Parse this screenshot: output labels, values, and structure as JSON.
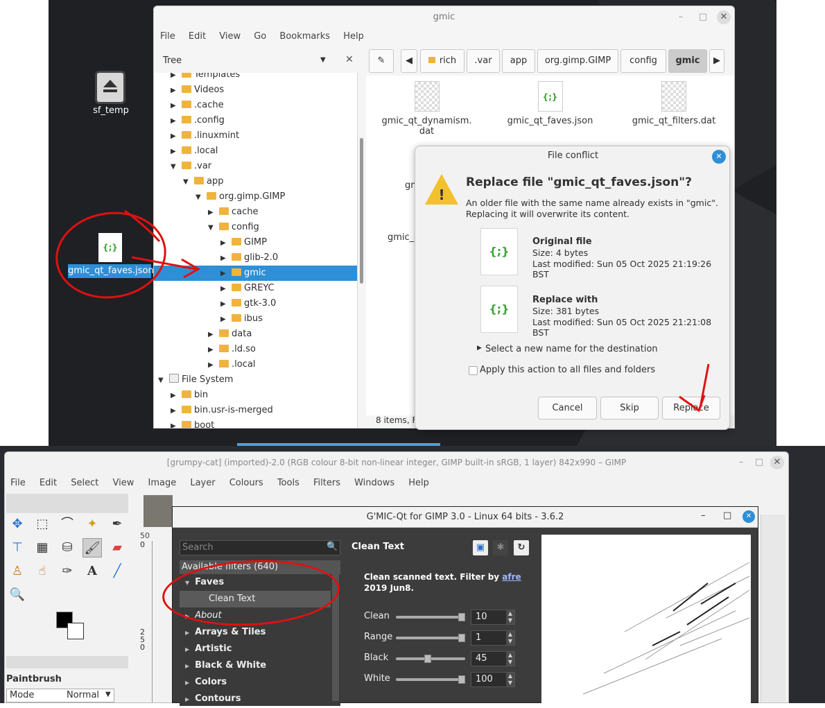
{
  "desktop": {
    "icon1_label": "sf_temp",
    "icon2_label": "gmic_qt_faves.json"
  },
  "nemo": {
    "title": "gmic",
    "menu": [
      "File",
      "Edit",
      "View",
      "Go",
      "Bookmarks",
      "Help"
    ],
    "sidebar_mode": "Tree",
    "breadcrumbs": [
      "rich",
      ".var",
      "app",
      "org.gimp.GIMP",
      "config",
      "gmic"
    ],
    "tree": [
      {
        "label": "Templates",
        "depth": 1,
        "arrow": "▶"
      },
      {
        "label": "Videos",
        "depth": 1,
        "arrow": "▶"
      },
      {
        "label": ".cache",
        "depth": 1,
        "arrow": "▶"
      },
      {
        "label": ".config",
        "depth": 1,
        "arrow": "▶"
      },
      {
        "label": ".linuxmint",
        "depth": 1,
        "arrow": "▶"
      },
      {
        "label": ".local",
        "depth": 1,
        "arrow": "▶"
      },
      {
        "label": ".var",
        "depth": 1,
        "arrow": "▼"
      },
      {
        "label": "app",
        "depth": 2,
        "arrow": "▼"
      },
      {
        "label": "org.gimp.GIMP",
        "depth": 3,
        "arrow": "▼"
      },
      {
        "label": "cache",
        "depth": 4,
        "arrow": "▶"
      },
      {
        "label": "config",
        "depth": 4,
        "arrow": "▼"
      },
      {
        "label": "GIMP",
        "depth": 5,
        "arrow": "▶"
      },
      {
        "label": "glib-2.0",
        "depth": 5,
        "arrow": "▶"
      },
      {
        "label": "gmic",
        "depth": 5,
        "arrow": "▶",
        "selected": true
      },
      {
        "label": "GREYC",
        "depth": 5,
        "arrow": "▶"
      },
      {
        "label": "gtk-3.0",
        "depth": 5,
        "arrow": "▶"
      },
      {
        "label": "ibus",
        "depth": 5,
        "arrow": "▶"
      },
      {
        "label": "data",
        "depth": 4,
        "arrow": "▶"
      },
      {
        "label": ".ld.so",
        "depth": 4,
        "arrow": "▶"
      },
      {
        "label": ".local",
        "depth": 4,
        "arrow": "▶"
      },
      {
        "label": "File System",
        "depth": 0,
        "arrow": "▼",
        "drive": true
      },
      {
        "label": "bin",
        "depth": 1,
        "arrow": "▶"
      },
      {
        "label": "bin.usr-is-merged",
        "depth": 1,
        "arrow": "▶"
      },
      {
        "label": "boot",
        "depth": 1,
        "arrow": "▶"
      }
    ],
    "files": [
      {
        "name_line1": "gmic_qt_dynamism.",
        "name_line2": "dat"
      },
      {
        "name_line1": "gmic_qt_faves.json",
        "name_line2": ""
      },
      {
        "name_line1": "gmic_qt_filters.dat",
        "name_line2": ""
      }
    ],
    "partial_labels": [
      "gm",
      "gmic_c"
    ],
    "status": "8 items, F"
  },
  "dialog": {
    "title": "File conflict",
    "heading": "Replace file \"gmic_qt_faves.json\"?",
    "message_line1": "An older file with the same name already exists in \"gmic\".",
    "message_line2": "Replacing it will overwrite its content.",
    "original": {
      "title": "Original file",
      "size": "Size: 4 bytes",
      "modified": "Last modified: Sun 05 Oct 2025 21:19:26 BST"
    },
    "replacement": {
      "title": "Replace with",
      "size": "Size: 381 bytes",
      "modified": "Last modified: Sun 05 Oct 2025 21:21:08 BST"
    },
    "rename_expander": "Select a new name for the destination",
    "apply_all": "Apply this action to all files and folders",
    "buttons": {
      "cancel": "Cancel",
      "skip": "Skip",
      "replace": "Replace"
    },
    "json_glyph": "{;}"
  },
  "gimp": {
    "title": "[grumpy-cat] (imported)-2.0 (RGB colour 8-bit non-linear integer, GIMP built-in sRGB, 1 layer) 842x990 – GIMP",
    "menu": [
      "File",
      "Edit",
      "Select",
      "View",
      "Image",
      "Layer",
      "Colours",
      "Tools",
      "Filters",
      "Windows",
      "Help"
    ],
    "tool_options_title": "Paintbrush",
    "mode_label": "Mode",
    "mode_value": "Normal",
    "ruler_label": "50",
    "ruler_ticks": [
      "0",
      "2",
      "5",
      "0"
    ]
  },
  "gmic": {
    "title": "G'MIC-Qt for GIMP 3.0 - Linux 64 bits - 3.6.2",
    "search_placeholder": "Search",
    "filter_header": "Available filters (640)",
    "tree": [
      {
        "label": "Faves",
        "arrow": "▼",
        "bold": true
      },
      {
        "label": "Clean Text",
        "arrow": "",
        "child": true,
        "selected": true
      },
      {
        "label": "About",
        "arrow": "▶",
        "italic": true
      },
      {
        "label": "Arrays & Tiles",
        "arrow": "▶",
        "bold": true
      },
      {
        "label": "Artistic",
        "arrow": "▶",
        "bold": true
      },
      {
        "label": "Black & White",
        "arrow": "▶",
        "bold": true
      },
      {
        "label": "Colors",
        "arrow": "▶",
        "bold": true
      },
      {
        "label": "Contours",
        "arrow": "▶",
        "bold": true
      }
    ],
    "filter_name": "Clean Text",
    "description_line1": "Clean scanned text.  Filter by ",
    "description_author": "afre",
    "description_line2": "2019 Jun8.",
    "params": [
      {
        "label": "Clean",
        "value": "10",
        "level": 0.98
      },
      {
        "label": "Range",
        "value": "1",
        "level": 0.98
      },
      {
        "label": "Black",
        "value": "45",
        "level": 0.45
      },
      {
        "label": "White",
        "value": "100",
        "level": 0.98
      }
    ]
  }
}
